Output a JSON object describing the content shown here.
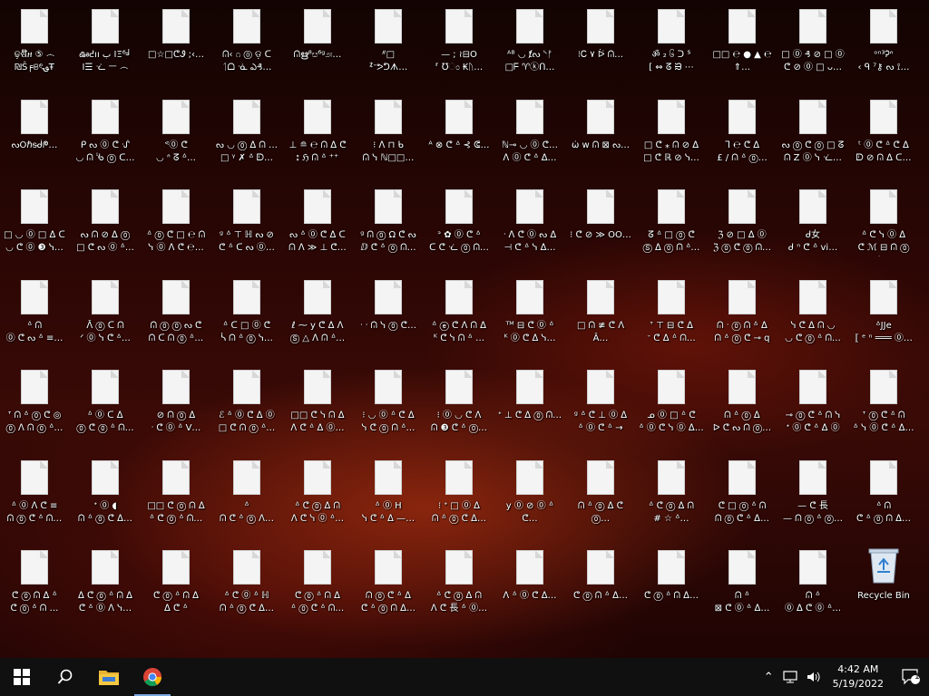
{
  "desktop": {
    "icons": [
      [
        "ଢ଼ଷ໊ዘ ⑤ ෴\n₪Ŝ╒ଞৎ؈Ŧ",
        "ఊᕍıı ب ΙΞ⁶╛\nΙ☰  ᓨ ㅡ ෴",
        "□☆□ᕦᏭ ;‹…",
        "ᕬ‹ ೧ ⓪ ଡ଼ ᑕ\nᛐᗝ ᓍ ఎ₰…",
        "ᕬഋ⁸ೞ⁶ᵍ೨⦂…",
        "ᐥ□\nᙇᐨᕗᕤᗑ…",
        "—  ; ≀⊟O\n⸢ ℧ಂ ₭ᚢ…",
        "ᴬᴮ ◡ ⱦᔓ ᔅᚠ\n□ᖴ ♈ⓚᑎ…",
        "⁝Ꮯ ۷ ᐖ ᕬ…",
        "ॐ ₂ ၆ ᑐ ᔆ\n[ ⇔ ᘔ ᙣ ⋯",
        "□□ ℮ ● ▲ ℮ ⇑…",
        "□ ⓪ ₰ ⊘ □ ⓪\nᕦ ⊘ ⓪ □ ᴗ…",
        "ᵒⁿ³Ꭾᐢ\n‹ ᑫ ⁷⚷ ᔓ ⟟…"
      ],
      [
        "ᔓОℏᵴᑰᖘ…",
        "ᑭ ᔓ ⓪ ᕦ ᔛ\n◡ ᕬ ᔎ ⓪ ᑕ…",
        "ᕝ⓪ ᕦ\n◡ ᐢ ᘔ ᐞ…",
        "ᔓ ◡ ⓪ ᐃ ᕬ …\n□ ᵞ ✗ ᐞ ᗟ…",
        "⊥ ≘ ℮ ᕬ ᐃ ᕦ\n⦂ ℌ ᕬ ᐞ ⁺⁺",
        "⁝ ᐱ ⊓ ᑲ\nᕬ ᓭ ℕ□□…",
        "ᴬ ⊗ ᕦ ᐞ ⊰ ᕳ…",
        "ℕ⊸ ◡ ⓪ ᕦ…\nᐱ ⓪ ᕦ ᐞ ᐃ…",
        "ω̇ w ᕬ ⊠ ᔓ…",
        "□ ᕦ ⁎ ᕬ ⊘ ᐃ\n□ ᕦ ℝ ⊘ ᓭ…",
        "ᒣ ℮ ᕦ ᐃ\n£ / ᕬ ᐞ ⓪…",
        "ᔓ ⓪ ᕦ ⓪ □ ᘔ\nᕬ Z ⓪ ᓭ ᓨ…",
        "ᵗ ⓪ ᕦ ᐞ ᕦ ᐃ\nᗟ ⊘ ᕬ ᐃ ᑕ…"
      ],
      [
        "□ ◡ ⓪ □ ᐃ ᑕ\n◡ ᕦ ⓪ ❸ ᓭ…",
        "ᔓ ᕬ ⊘ ᐃ ⓪\n□ ᕦ ᔓ ⓪ ᐞ…",
        "ᐞ ⓪ ᕦ □ ℮ ᕬ\nᓭ ⓪ ᐱ ᕦ ℮…",
        "ᵍ ᐞ ⊤ ℍ ᔓ ⊘\nᕦ ᐞ ᑕ ᔓ ⓪…",
        "ᔓ ᐞ ⓪ ᕦ ᐃ ᑕ\nᕬ ᐱ ≫ ⊥ ᕦ…",
        "ᵍ ᕬ ⓪ Ω ᕦ ᔓ\nⅅ ᕦ ᐞ ⓪ ᕬ…",
        "ᐣ ✿ ⓪ ᕦ ᐞ\nᑕ ᕦ ᓨ ⓪ ᕬ…",
        "ᐧ ᐱ ᕦ ⓪ ᔓ ᐃ\n⊣ ᕦ ᐞ ᓭ ᐃ…",
        "⁝ ᕦ ⊘ ≫ OO…",
        "ᘔ ᐞ □ ⓪ ᕦ\nⓈ ᐃ ⓪ ᕬ ᐞ…",
        "ℨ ⊘ □ ᐃ ⓪\nℨ ⓪ ᕦ ⓪ ᕬ…",
        "ᑯ女\nᑯ ⁿ ᕦ ᐞ vi…",
        "ᐞ ᕦ ᓭ ⓪ ᐃ\nᕦ ℳ ⊟ ᕬ ⓪ ᐞ…"
      ],
      [
        "ᐞ ᕬ\n⓪ ᕦ ᔓ ᐞ ≡…",
        "ᐰ ⓪ ᑕ ᕬ\nᐟ ⓪ ᓭ ᕦ ᐞ…",
        "ᕬ ⓪ ⓪ ᔓ ᕦ\nᕬ ᑕ ᕬ ⓪ ᐞ…",
        "ᐞ ᑕ □ ⓪ ᕦ\nᓵ ᕬ ᐞ ⓪ ᓭ…",
        "ℓ ⁓ y ᕦ ᐃ ᐱ\nⓈ △ ᐱ ᕬ ᐞ…",
        "ᐧ ᐧ ᕬ ᓭ ⓪ ᕦ…",
        "ᐞ ⓔ ᕦ ᐱ ᕬ ᐃ\nᴷ ᕦ ᓭ ᕬ ᐞ …",
        "ᵀᴹ ⊟ ᕦ ⓪ ᐞ\nᴷ ⓪ ᕦ ᐃ ᓭ…",
        "□ ᕬ ≢ ᕦ ᐱ Â…",
        "ᐪ ⊤ ⊟ ᕦ ᐃ\nᐨ ᕦ ᐃ ᐞ ᕬ…",
        "ᕬ ᐧ ⓪ ᕬ ᐞ ᐃ\nᕬ ᐞ ⓪ ᕦ ⊸ q",
        "ᓭ ᕦ ᐃ ᕬ ◡\n◡ ᕦ ⓪ ᐞ ᕬ…",
        "ᐞJJe\n⟦ ᵉ ⁿ ═══ ⓪…"
      ],
      [
        "ᐪ ᕬ ᐞ ⓪ ᕦ ◎\n⓪ ᐱ ᕬ ⓪ ᐞ…",
        "ᐞ ⓪ ᑕ ᐃ\n⓪ ᕦ ⓪ ᐞ ᕬ…",
        "⊘ ᕬ ⓪ ᐃ\nᐧ ᕦ ⓪ ᐞ V…",
        "ℰ ᐞ ⓪ ᕦ ᐃ ⓪\n□ ᕦ ᕬ ⓪ ᐞ…",
        "□□ ᕦ ᓭ ᕬ ᐃ\nᐱ ᕦ ᐞ ᐃ ⓪…",
        "⁝ ◡ ⓪ ᐞ ᕦ ᐃ\nᓭ ᕦ ⓪ ᕬ ᐞ…",
        "⁝ ⓪ ◡ ᕦ ᐱ\nᕬ ❸ ᕦ ᐞ ⓪…",
        "ᐩ ⊥ ᕦ ᐃ ⓪ ᕬ…",
        "ᵍ ᐞ ᕦ ⊥ ⓪ ᐃ\nᐞ ⓪ ᕦ ᐞ →",
        "ᓄ ⓪ □ ᐞ ᕦ\nᐞ ⓪ ᕦ ᓭ ⓪ ᐃ…",
        "ᕬ ᐞ ⓪ ᐃ\nᐅ ᕦ ᔓ ᕬ ⓪…",
        "⊸ ⓪ ᕦ ᐞ ᕬ ᓭ\nᐩ ⓪ ᕦ ᐞ ᐃ ⓪",
        "ᐪ ⓪ ᕦ ᐞ ᕬ\nᐞ ᓭ ⓪ ᕦ ᐞ ᐃ…"
      ],
      [
        "ᐞ ⓪ ᐱ ᕦ ≡\nᕬ ⓪ ᕦ ᐞ ᕬ…",
        "ᐩ ⓪ ◖\nᕬ ᐞ ⓪ ᕦ ᐃ…",
        "□□ ᕦ ⓪ ᕬ ᐃ\nᐞ ᕦ ⓪ ᐞ ᕬ…",
        "ᐞ\nᕬ ᕦ ᐞ ⓪ ᐱ…",
        "ᐞ ᕦ ⓪ ᐃ ᕬ\nᐱ ᕦ ᓭ ⓪ ᐞ…",
        "ᐞ ⓪ H\nᓭ ᕦ ᐞ ᐃ —…",
        "⁝ ᐩ □ ⓪ ᐃ\nᕬ ᐞ ⓪ ᕦ ᐃ…",
        "y ⓪ ⊘ ⓪ ᐞ ᕦ…",
        "ᕬ ᐞ ⓪ ᐃ ᕦ ⓪…",
        "ᐞ ᕦ ⓪ ᐃ ᕬ\n# ☆ ᐞ…",
        "ᕦ □ ⓪ ᐞ ᕬ\nᕬ ⓪ ᕦ ᐞ ᐃ…",
        "— ᕦ 長\n— ᕬ ⓪ ᐞ ⓪…",
        "ᐞ ᕬ\nᕦ ᐞ ⓪ ᕬ ᐃ…"
      ],
      [
        "ᕦ ⓪ ᕬ ᐃ ᐞ\nᕦ ⓪ ᐞ ᕬ …",
        "ᐃ ᕦ ⓪ ᐞ ᕬ ᐃ\nᕦ ᐞ ⓪ ᐱ ᓭ…",
        "ᕦ ⓪ ᐞ ᕬ ᐃ\nᐃ ᕦ ᐞ",
        "ᐞ ᕦ ⓪ ᐞ ℍ\nᕬ ᐞ ⓪ ᕦ ᐃ…",
        "ᕦ ⓪ ᐞ ᕬ ᐃ\nᐞ ⓪ ᕦ ᐞ ᕬ…",
        "ᕬ ⓪ ᕦ ᐞ ᐃ\nᕦ ᐞ ⓪ ᕬ ᐃ…",
        "ᐞ ᕦ ⓪ ᐃ ᕬ\nᐱ ᕦ 長 ᐞ ⓪…",
        "ᐱ ᐞ ⓪ ᕦ ᐃ…",
        "ᕦ ⓪ ᕬ ᐞ ᐃ…",
        "ᕦ ⓪ ᐞ ᕬ ᐃ…",
        "ᕬ ᐞ\n⊠ ᕦ ⓪ ᐞ ᐃ…",
        "ᕬ ᐞ\n⓪ ᐃ ᕦ ⓪ ᐞ…",
        "Recycle Bin"
      ]
    ]
  },
  "recycle_bin": {
    "label": "Recycle Bin",
    "icon": "recycle-bin-icon"
  },
  "taskbar": {
    "start_icon": "windows-start-icon",
    "search_icon": "search-icon",
    "apps": [
      {
        "name": "file-explorer",
        "icon": "folder-icon"
      },
      {
        "name": "chrome",
        "icon": "chrome-icon",
        "active": true
      }
    ],
    "tray": {
      "time": "4:42 AM",
      "date": "5/19/2022",
      "notification_count": "1"
    }
  },
  "colors": {
    "taskbar_bg": "#101010",
    "accent": "#7aa7e0"
  }
}
